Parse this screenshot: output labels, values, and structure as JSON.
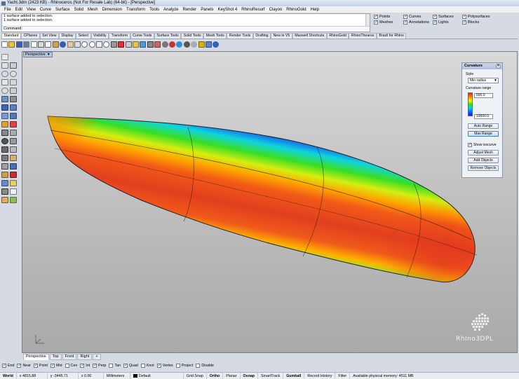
{
  "window": {
    "title": "Yacht.3dm (2423 KB) - Rhinoceros (Not For Resale Lab) (64-bit) - [Perspective]"
  },
  "menu": [
    "File",
    "Edit",
    "View",
    "Curve",
    "Surface",
    "Solid",
    "Mesh",
    "Dimension",
    "Transform",
    "Tools",
    "Analyze",
    "Render",
    "Panels",
    "KeyShot 4",
    "RhinoResurf",
    "Clayoo",
    "RhinoGold",
    "Help"
  ],
  "command": {
    "history": [
      "1 surface added to selection.",
      "1 surface added to selection."
    ],
    "prompt": "Command:"
  },
  "filters": [
    {
      "label": "Points",
      "checked": true
    },
    {
      "label": "Curves",
      "checked": true
    },
    {
      "label": "Surfaces",
      "checked": true
    },
    {
      "label": "Polysurfaces",
      "checked": true
    },
    {
      "label": "Meshes",
      "checked": true
    },
    {
      "label": "Annotations",
      "checked": true
    },
    {
      "label": "Lights",
      "checked": true
    },
    {
      "label": "Blocks",
      "checked": true
    }
  ],
  "toolbar_tabs": [
    "Standard",
    "CPlanes",
    "Set View",
    "Display",
    "Select",
    "Visibility",
    "Transform",
    "Curve Tools",
    "Surface Tools",
    "Solid Tools",
    "Mesh Tools",
    "Render Tools",
    "Drafting",
    "New in V5",
    "Maxwell Shortcuts",
    "RhinoGold",
    "RhinoThearos",
    "Brazil for Rhino"
  ],
  "viewport": {
    "label": "Perspective"
  },
  "curvature_panel": {
    "title": "Curvature",
    "close": "×",
    "style_label": "Style",
    "style_value": "Min radius",
    "range_label": "Curvature range",
    "range_min": "500.0",
    "range_max": "10000.0",
    "buttons": [
      "Auto Range",
      "Max Range"
    ],
    "show_isocurve": "Show isocurve",
    "actions": [
      "Adjust Mesh",
      "Add Objects",
      "Remove Objects"
    ]
  },
  "watermark": "RhIno3DPL",
  "viewport_tabs": [
    "Perspective",
    "Top",
    "Front",
    "Right"
  ],
  "viewport_tabs_add": "+",
  "osnaps": [
    {
      "label": "End",
      "checked": true
    },
    {
      "label": "Near",
      "checked": true
    },
    {
      "label": "Point",
      "checked": true
    },
    {
      "label": "Mid",
      "checked": true
    },
    {
      "label": "Cen",
      "checked": false
    },
    {
      "label": "Int",
      "checked": true
    },
    {
      "label": "Perp",
      "checked": true
    },
    {
      "label": "Tan",
      "checked": false
    },
    {
      "label": "Quad",
      "checked": true
    },
    {
      "label": "Knot",
      "checked": false
    },
    {
      "label": "Vertex",
      "checked": true
    },
    {
      "label": "Project",
      "checked": false
    },
    {
      "label": "Disable",
      "checked": false
    }
  ],
  "status": {
    "cplane": "World",
    "x": "x 4815.88",
    "y": "y -3445.71",
    "z": "z 0.00",
    "units": "Millimeters",
    "layer": "Default",
    "toggles": [
      "Grid Snap",
      "Ortho",
      "Planar",
      "Osnap",
      "SmartTrack",
      "Gumball",
      "Record History",
      "Filter"
    ],
    "memory": "Available physical memory: 4511 MB"
  }
}
